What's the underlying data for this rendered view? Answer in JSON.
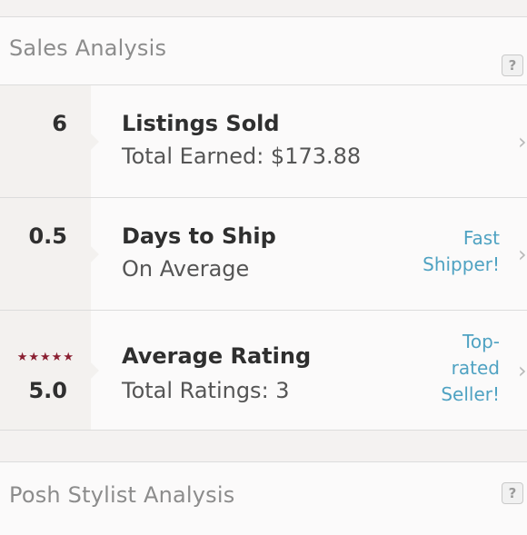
{
  "sales": {
    "title": "Sales Analysis",
    "help_label": "?",
    "rows": [
      {
        "value": "6",
        "title": "Listings Sold",
        "subtitle": "Total Earned: $173.88"
      },
      {
        "value": "0.5",
        "title": "Days to Ship",
        "subtitle": "On Average",
        "badge_lines": [
          "Fast",
          "Shipper!"
        ]
      },
      {
        "value": "5.0",
        "title": "Average Rating",
        "subtitle": "Total Ratings: 3",
        "stars": "★★★★★",
        "badge_lines": [
          "Top-",
          "rated",
          "Seller!"
        ]
      }
    ]
  },
  "stylist": {
    "title": "Posh Stylist Analysis",
    "help_label": "?"
  },
  "icons": {
    "chevron": "chevron-right-icon",
    "help": "help-icon",
    "star": "star-icon"
  },
  "colors": {
    "link_blue": "#4fa2c2",
    "star_red": "#8a1f31"
  }
}
